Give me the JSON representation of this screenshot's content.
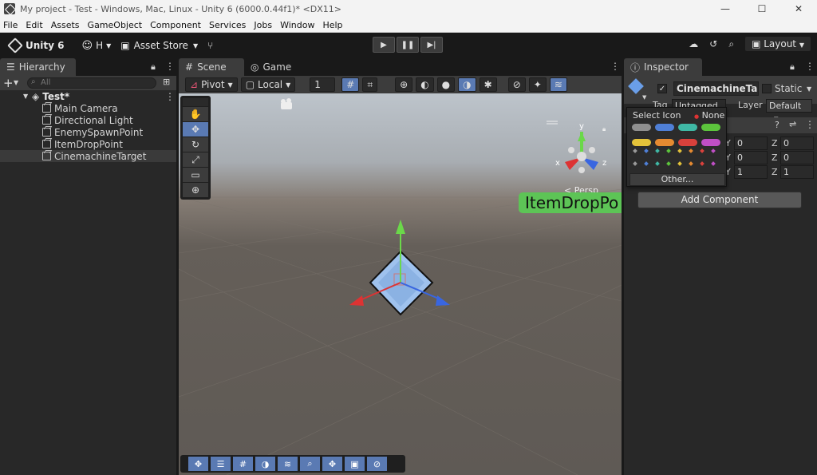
{
  "window": {
    "title": "My project - Test - Windows, Mac, Linux - Unity 6 (6000.0.44f1)* <DX11>",
    "controls": [
      "—",
      "☐",
      "✕"
    ]
  },
  "menu": [
    "File",
    "Edit",
    "Assets",
    "GameObject",
    "Component",
    "Services",
    "Jobs",
    "Window",
    "Help"
  ],
  "toolbar": {
    "unity_label": "Unity 6",
    "account_label": "H",
    "asset_store_label": "Asset Store",
    "layout_label": "Layout"
  },
  "hierarchy": {
    "tab_label": "Hierarchy",
    "search_placeholder": "All",
    "scene_name": "Test*",
    "items": [
      {
        "label": "Main Camera"
      },
      {
        "label": "Directional Light"
      },
      {
        "label": "EnemySpawnPoint"
      },
      {
        "label": "ItemDropPoint"
      },
      {
        "label": "CinemachineTarget"
      }
    ]
  },
  "scene": {
    "tabs": [
      {
        "label": "Scene"
      },
      {
        "label": "Game"
      }
    ],
    "pivot_label": "Pivot",
    "local_label": "Local",
    "grid_value": "1",
    "persp_label": "< Persp",
    "label_text": "ItemDropPo",
    "axis_labels": {
      "y": "y",
      "x": "x",
      "z": "z"
    }
  },
  "inspector": {
    "tab_label": "Inspector",
    "object_name": "CinemachineTarge",
    "static_label": "Static",
    "tag_label": "Tag",
    "tag_value": "Untagged",
    "layer_label": "Layer",
    "layer_value": "Default",
    "transform_rows": [
      {
        "y_label": "Y",
        "y": "0",
        "z_label": "Z",
        "z": "0"
      },
      {
        "y_label": "Y",
        "y": "0",
        "z_label": "Z",
        "z": "0"
      },
      {
        "y_label": "Y",
        "y": "1",
        "z_label": "Z",
        "z": "1"
      }
    ],
    "add_component_label": "Add Component"
  },
  "select_icon_popup": {
    "title": "Select Icon",
    "none_label": "None",
    "other_label": "Other...",
    "pill_colors": [
      "#8f8f8f",
      "#4f7fd6",
      "#3fb8a5",
      "#5cc43c",
      "#e3c23a",
      "#e58a31",
      "#d9413c",
      "#c04fc6"
    ],
    "dot_colors": [
      "#999999",
      "#4f7fd6",
      "#3fb8a5",
      "#5cc43c",
      "#e3c23a",
      "#e58a31",
      "#d9413c",
      "#c04fc6"
    ]
  },
  "colors": {
    "accent_blue": "#5a7ab3",
    "label_green": "#5dc456"
  }
}
